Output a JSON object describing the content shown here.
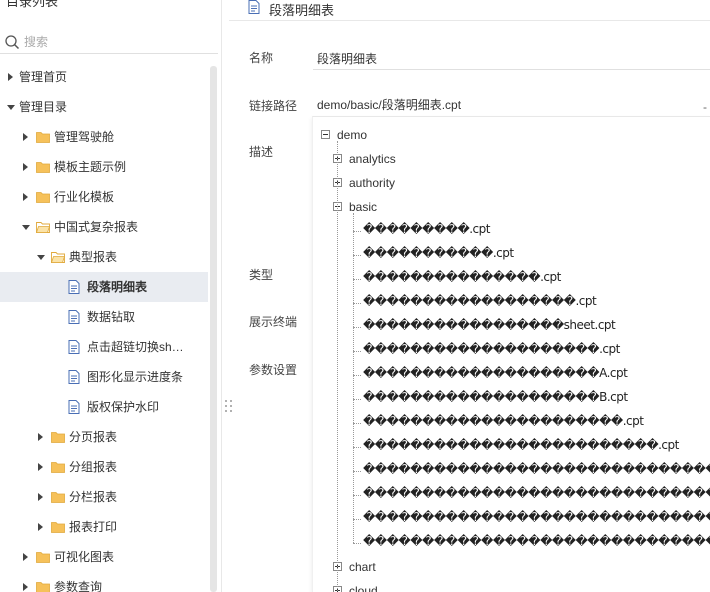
{
  "sidebar": {
    "title": "目录列表",
    "more": "···",
    "search_placeholder": "搜索",
    "items": [
      {
        "label": "管理首页",
        "level": 0,
        "arrow": "collapsed",
        "icon": "none"
      },
      {
        "label": "管理目录",
        "level": 0,
        "arrow": "expanded",
        "icon": "none"
      },
      {
        "label": "管理驾驶舱",
        "level": 1,
        "arrow": "collapsed",
        "icon": "folder"
      },
      {
        "label": "模板主题示例",
        "level": 1,
        "arrow": "collapsed",
        "icon": "folder"
      },
      {
        "label": "行业化模板",
        "level": 1,
        "arrow": "collapsed",
        "icon": "folder"
      },
      {
        "label": "中国式复杂报表",
        "level": 1,
        "arrow": "expanded",
        "icon": "folder-open"
      },
      {
        "label": "典型报表",
        "level": 2,
        "arrow": "expanded",
        "icon": "folder-open"
      },
      {
        "label": "段落明细表",
        "level": 3,
        "arrow": "none",
        "icon": "file",
        "selected": true
      },
      {
        "label": "数据钻取",
        "level": 3,
        "arrow": "none",
        "icon": "file"
      },
      {
        "label": "点击超链切换sh…",
        "level": 3,
        "arrow": "none",
        "icon": "file"
      },
      {
        "label": "图形化显示进度条",
        "level": 3,
        "arrow": "none",
        "icon": "file"
      },
      {
        "label": "版权保护水印",
        "level": 3,
        "arrow": "none",
        "icon": "file"
      },
      {
        "label": "分页报表",
        "level": 2,
        "arrow": "collapsed",
        "icon": "folder"
      },
      {
        "label": "分组报表",
        "level": 2,
        "arrow": "collapsed",
        "icon": "folder"
      },
      {
        "label": "分栏报表",
        "level": 2,
        "arrow": "collapsed",
        "icon": "folder"
      },
      {
        "label": "报表打印",
        "level": 2,
        "arrow": "collapsed",
        "icon": "folder"
      },
      {
        "label": "可视化图表",
        "level": 1,
        "arrow": "collapsed",
        "icon": "folder"
      },
      {
        "label": "参数查询",
        "level": 1,
        "arrow": "collapsed",
        "icon": "folder"
      }
    ]
  },
  "main": {
    "title": "段落明细表",
    "fields": {
      "name_label": "名称",
      "name_value": "段落明细表",
      "path_label": "链接路径",
      "path_value": "demo/basic/段落明细表.cpt",
      "desc_label": "描述",
      "type_label": "类型",
      "terminal_label": "展示终端",
      "param_label": "参数设置"
    }
  },
  "file_tree": {
    "root": "demo",
    "folders_before": [
      "analytics",
      "authority"
    ],
    "open_folder": "basic",
    "files": [
      "���������.cpt",
      "�����������.cpt",
      "���������������.cpt",
      "������������������.cpt",
      "�����������������sheet.cpt",
      "��������������������.cpt",
      "��������������������A.cpt",
      "��������������������B.cpt",
      "����������������������.cpt",
      "�������������������������.cpt",
      "������������������������������",
      "������������������������������",
      "������������������������������",
      "������������������������������"
    ],
    "folders_after": [
      "chart",
      "cloud"
    ]
  },
  "colors": {
    "folder": "#f6c15a",
    "file_icon": "#4a6fb5",
    "selected_bg": "#e9ecf1"
  }
}
